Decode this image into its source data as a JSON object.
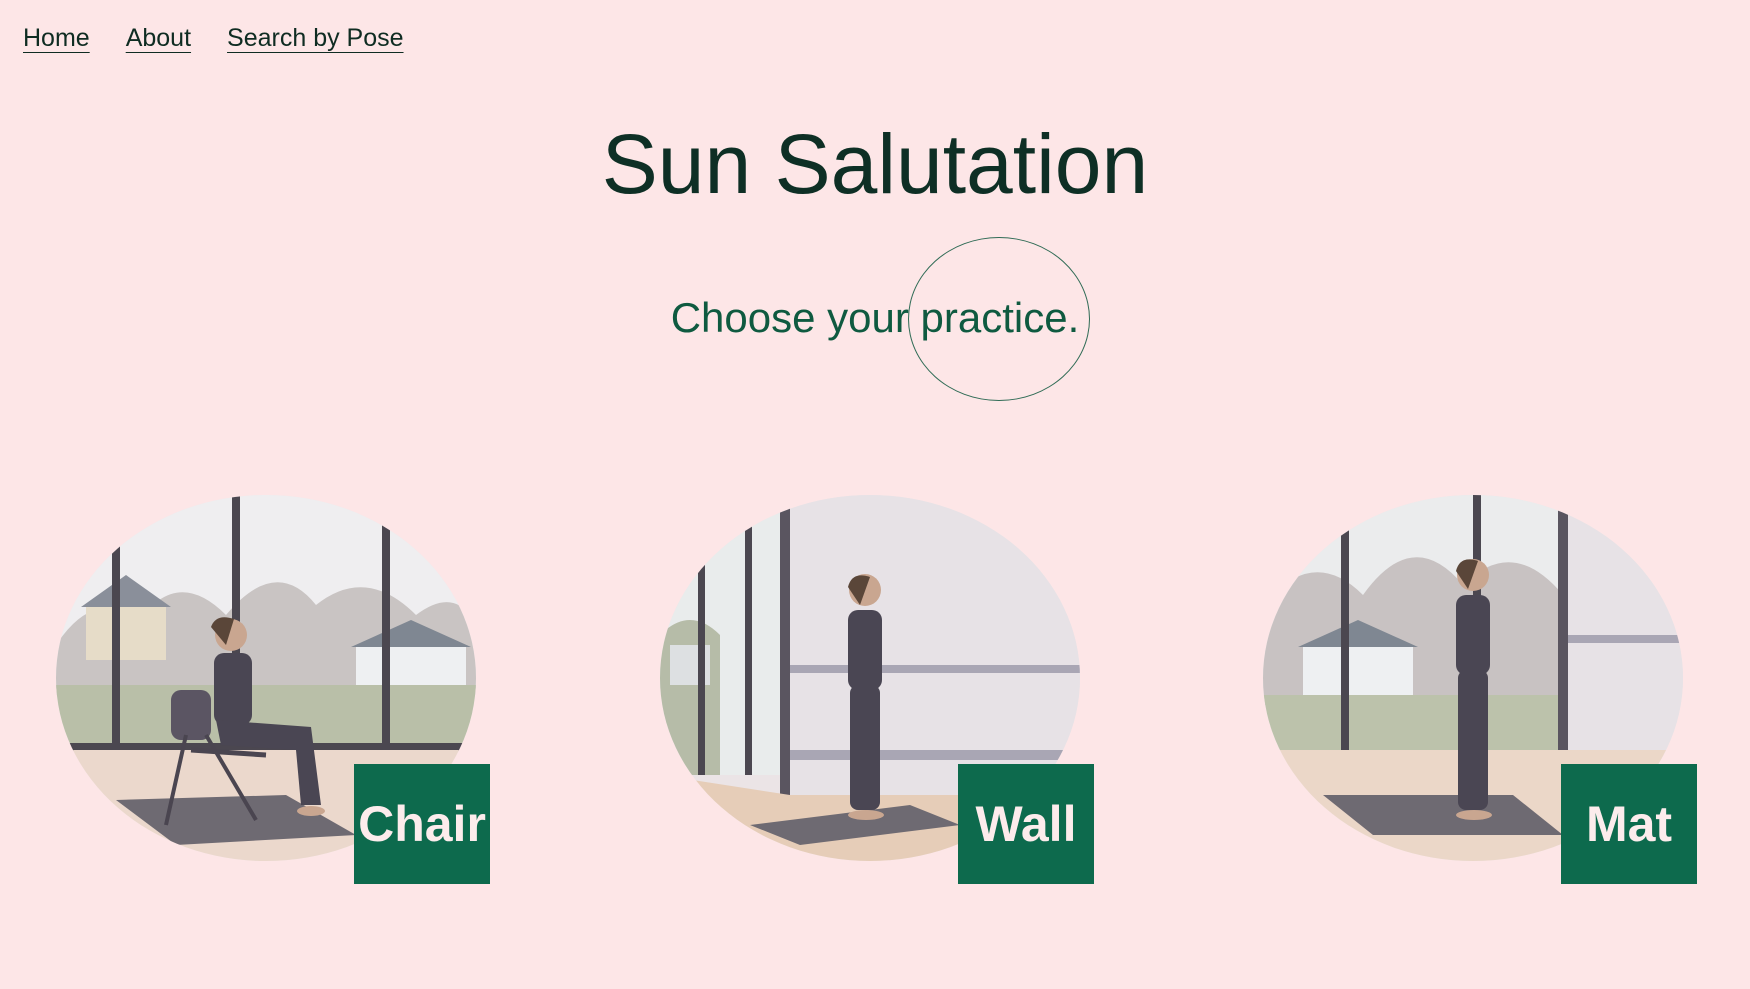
{
  "nav": {
    "home": "Home",
    "about": "About",
    "search": "Search by Pose"
  },
  "page": {
    "title": "Sun Salutation",
    "subtitle": "Choose your practice."
  },
  "options": [
    {
      "label": "Chair"
    },
    {
      "label": "Wall"
    },
    {
      "label": "Mat"
    }
  ],
  "colors": {
    "background": "#fde6e7",
    "accent": "#0d6a4d",
    "title": "#0e2f25"
  }
}
